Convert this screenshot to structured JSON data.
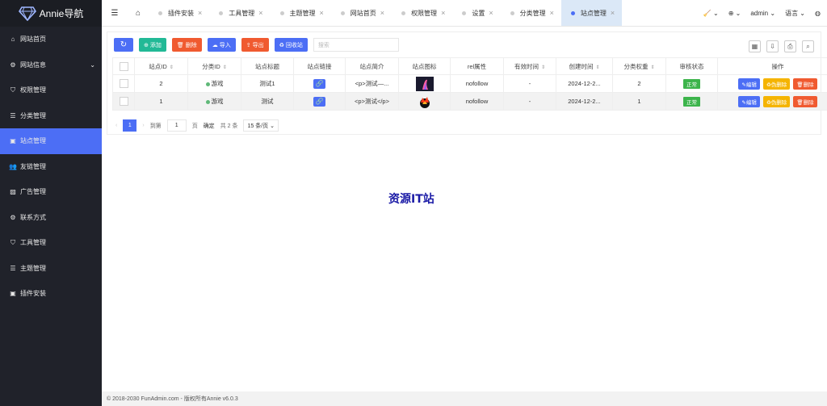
{
  "app": {
    "title": "Annie导航"
  },
  "sidebar": {
    "items": [
      {
        "label": "网站首页",
        "icon": "home-icon"
      },
      {
        "label": "网站信息",
        "icon": "gear-icon"
      },
      {
        "label": "权限管理",
        "icon": "shield-icon"
      },
      {
        "label": "分类管理",
        "icon": "list-icon"
      },
      {
        "label": "站点管理",
        "icon": "windows-icon"
      },
      {
        "label": "友链管理",
        "icon": "users-icon"
      },
      {
        "label": "广告管理",
        "icon": "image-icon"
      },
      {
        "label": "联系方式",
        "icon": "gear-icon"
      },
      {
        "label": "工具管理",
        "icon": "shield-icon"
      },
      {
        "label": "主题管理",
        "icon": "list-icon"
      },
      {
        "label": "插件安装",
        "icon": "windows-icon"
      }
    ]
  },
  "tabs": [
    {
      "label": "插件安装"
    },
    {
      "label": "工具管理"
    },
    {
      "label": "主题管理"
    },
    {
      "label": "网站首页"
    },
    {
      "label": "权限管理"
    },
    {
      "label": "设置"
    },
    {
      "label": "分类管理"
    },
    {
      "label": "站点管理"
    }
  ],
  "topbar": {
    "user": "admin",
    "language": "语言"
  },
  "toolbar": {
    "add": "添加",
    "delete": "删除",
    "import": "导入",
    "export": "导出",
    "recycle": "回收站",
    "search_placeholder": "搜索"
  },
  "table": {
    "headers": [
      "站点ID",
      "分类ID",
      "站点标题",
      "站点链接",
      "站点简介",
      "站点图标",
      "rel属性",
      "有效时间",
      "创建时间",
      "分类权重",
      "审核状态",
      "操作"
    ],
    "rows": [
      {
        "id": "2",
        "category": "游戏",
        "title": "测试1",
        "intro": "<p>测试—...",
        "rel": "nofollow",
        "valid": "-",
        "created": "2024-12-2...",
        "weight": "2",
        "status": "正常"
      },
      {
        "id": "1",
        "category": "游戏",
        "title": "测试",
        "intro": "<p>测试</p>",
        "rel": "nofollow",
        "valid": "-",
        "created": "2024-12-2...",
        "weight": "1",
        "status": "正常"
      }
    ],
    "actions": {
      "edit": "编辑",
      "soft_delete": "伪删除",
      "delete": "删除"
    }
  },
  "pager": {
    "current": "1",
    "goto": "到第",
    "page_input": "1",
    "page_unit": "页",
    "confirm": "确定",
    "total": "共 2 条",
    "per_page": "15 条/页"
  },
  "watermark": "资源IT站",
  "footer": "© 2018-2030 FunAdmin.com - 版权所有Annie v6.0.3",
  "colors": {
    "sidebar": "#20222a",
    "accent": "#4c6ef5",
    "green": "#22b996",
    "red": "#f05a30",
    "yellow": "#f5b400"
  }
}
